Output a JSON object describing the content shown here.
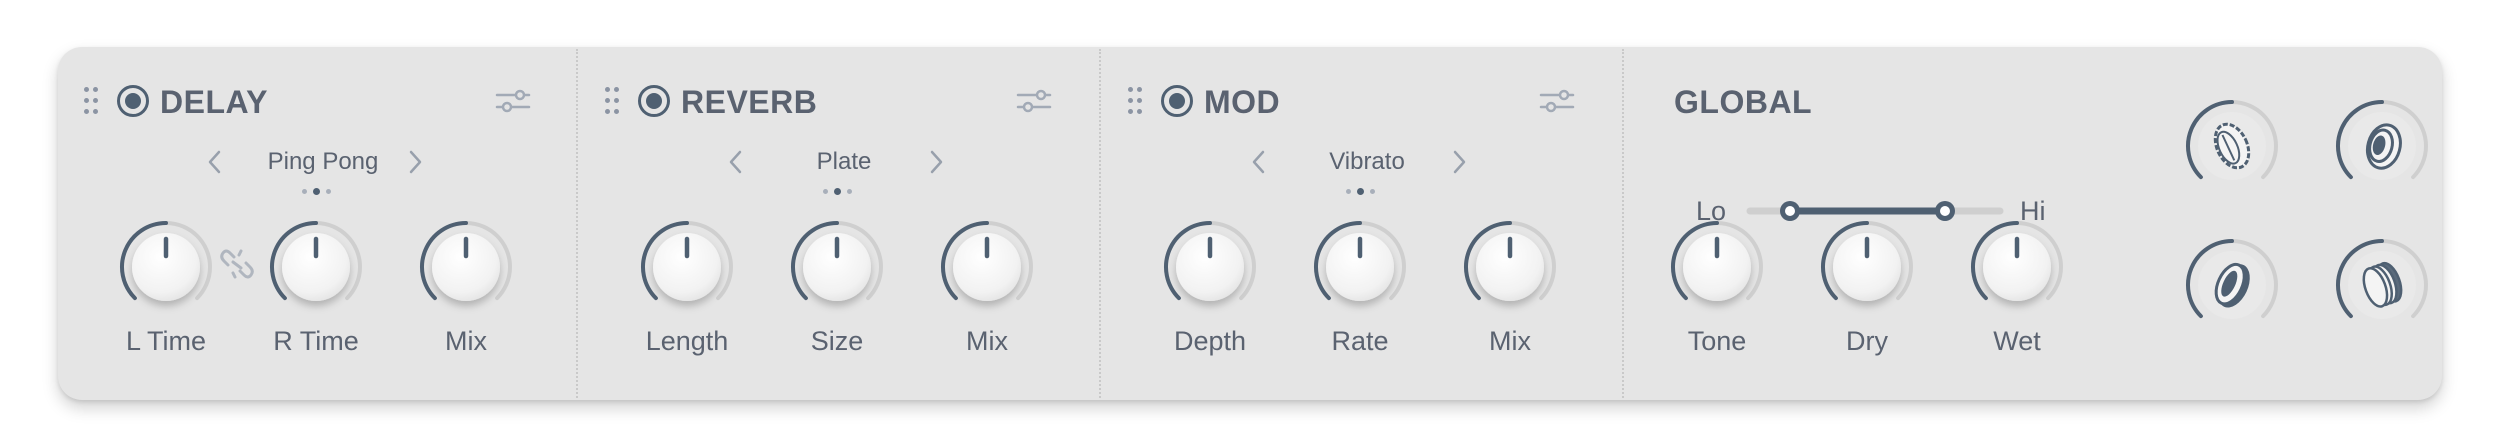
{
  "colors": {
    "panel": "#e5e5e5",
    "accent": "#4f6072",
    "track": "#cfcfcf",
    "text": "#5a6270"
  },
  "sections": [
    {
      "title": "DELAY",
      "preset": "Ping Pong",
      "knobs": [
        {
          "label": "L Time",
          "value": 0.5
        },
        {
          "label": "R Time",
          "value": 0.5
        },
        {
          "label": "Mix",
          "value": 0.5
        }
      ],
      "icons": [
        "drag-handle-icon",
        "power-icon",
        "settings-sliders-icon",
        "chevron-left-icon",
        "chevron-right-icon",
        "link-broken-icon"
      ]
    },
    {
      "title": "REVERB",
      "preset": "Plate",
      "knobs": [
        {
          "label": "Length",
          "value": 0.5
        },
        {
          "label": "Size",
          "value": 0.5
        },
        {
          "label": "Mix",
          "value": 0.5
        }
      ],
      "icons": [
        "drag-handle-icon",
        "power-icon",
        "settings-sliders-icon",
        "chevron-left-icon",
        "chevron-right-icon"
      ]
    },
    {
      "title": "MOD",
      "preset": "Vibrato",
      "knobs": [
        {
          "label": "Depth",
          "value": 0.5
        },
        {
          "label": "Rate",
          "value": 0.5
        },
        {
          "label": "Mix",
          "value": 0.5
        }
      ],
      "icons": [
        "drag-handle-icon",
        "power-icon",
        "settings-sliders-icon",
        "chevron-left-icon",
        "chevron-right-icon"
      ]
    }
  ],
  "global": {
    "title": "GLOBAL",
    "range": {
      "lo_label": "Lo",
      "hi_label": "Hi",
      "low": 0.16,
      "high": 0.78
    },
    "knobs": [
      {
        "label": "Tone",
        "value": 0.5
      },
      {
        "label": "Dry",
        "value": 0.5
      },
      {
        "label": "Wet",
        "value": 0.5
      }
    ],
    "fx_buttons": [
      "cymbal-icon",
      "speaker-rings-icon",
      "drum-icon",
      "layered-discs-icon"
    ]
  }
}
